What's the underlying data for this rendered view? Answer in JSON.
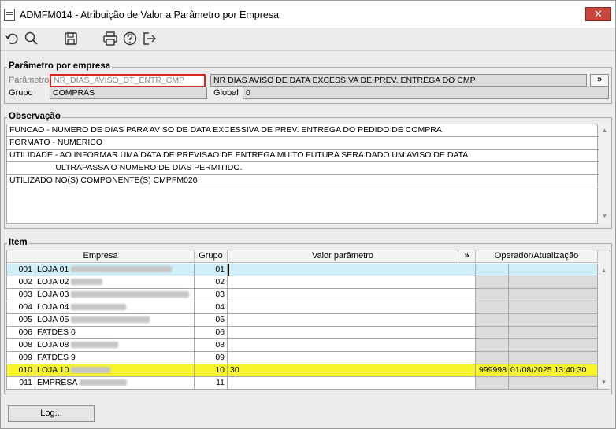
{
  "window": {
    "title": "ADMFM014 - Atribuição de Valor a Parâmetro por Empresa",
    "close_label": "✕"
  },
  "toolbar": {
    "icons": [
      "undo-icon",
      "search-icon",
      "save-icon",
      "print-icon",
      "help-icon",
      "exit-icon"
    ]
  },
  "param_group": {
    "title": "Parâmetro por empresa",
    "parametro_label": "Parâmetro",
    "parametro_value": "NR_DIAS_AVISO_DT_ENTR_CMP",
    "parametro_desc": "NR DIAS AVISO DE DATA EXCESSIVA DE PREV. ENTREGA DO CMP",
    "more_label": "»",
    "grupo_label": "Grupo",
    "grupo_value": "COMPRAS",
    "global_label": "Global",
    "global_value": "0"
  },
  "obs_group": {
    "title": "Observação",
    "lines": [
      "FUNCAO - NUMERO DE DIAS PARA AVISO DE DATA EXCESSIVA DE PREV. ENTREGA DO PEDIDO DE COMPRA",
      "FORMATO -  NUMERICO",
      "UTILIDADE - AO INFORMAR UMA DATA DE PREVISAO DE ENTREGA MUITO FUTURA SERA DADO UM AVISO DE DATA",
      "                    ULTRAPASSA O NUMERO DE DIAS PERMITIDO.",
      "UTILIZADO NO(S) COMPONENTE(S) CMPFM020"
    ]
  },
  "item_group": {
    "title": "Item",
    "columns": {
      "empresa": "Empresa",
      "grupo": "Grupo",
      "valor": "Valor parâmetro",
      "more": "»",
      "operador": "Operador/Atualização"
    },
    "rows": [
      {
        "num": "001",
        "name": "LOJA 01",
        "grupo": "01",
        "valor": "",
        "operador": "",
        "data": "",
        "state": "active"
      },
      {
        "num": "002",
        "name": "LOJA 02",
        "grupo": "02",
        "valor": "",
        "operador": "",
        "data": "",
        "state": ""
      },
      {
        "num": "003",
        "name": "LOJA 03",
        "grupo": "03",
        "valor": "",
        "operador": "",
        "data": "",
        "state": ""
      },
      {
        "num": "004",
        "name": "LOJA 04",
        "grupo": "04",
        "valor": "",
        "operador": "",
        "data": "",
        "state": ""
      },
      {
        "num": "005",
        "name": "LOJA 05",
        "grupo": "05",
        "valor": "",
        "operador": "",
        "data": "",
        "state": ""
      },
      {
        "num": "006",
        "name": "FATDES 0",
        "grupo": "06",
        "valor": "",
        "operador": "",
        "data": "",
        "state": ""
      },
      {
        "num": "008",
        "name": "LOJA 08",
        "grupo": "08",
        "valor": "",
        "operador": "",
        "data": "",
        "state": ""
      },
      {
        "num": "009",
        "name": "FATDES 9",
        "grupo": "09",
        "valor": "",
        "operador": "",
        "data": "",
        "state": ""
      },
      {
        "num": "010",
        "name": "LOJA 10",
        "grupo": "10",
        "valor": "30",
        "operador": "999998",
        "data": "01/08/2025 13:40:30",
        "state": "highlight"
      },
      {
        "num": "011",
        "name": "EMPRESA",
        "grupo": "11",
        "valor": "",
        "operador": "",
        "data": "",
        "state": ""
      }
    ]
  },
  "footer": {
    "log_label": "Log..."
  },
  "colors": {
    "highlight_row": "#f7f42a",
    "active_row": "#cfeef8",
    "focus_border": "#d9241c",
    "close_button": "#c9463d"
  }
}
